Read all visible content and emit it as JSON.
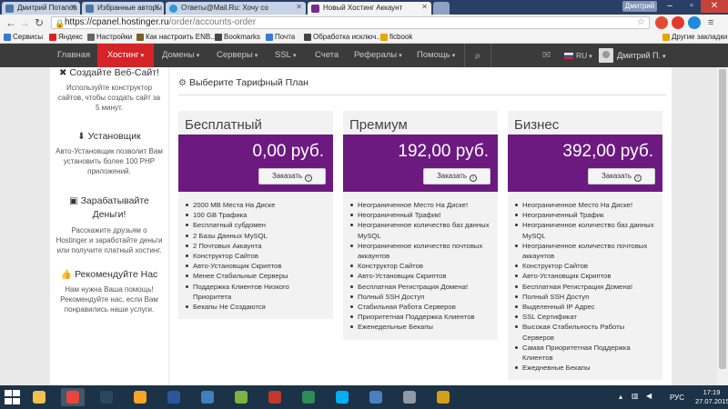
{
  "browser": {
    "tabs": [
      {
        "title": "Дмитрий Потапов",
        "color": "#4a76a8"
      },
      {
        "title": "Избранные авторы",
        "color": "#4a76a8"
      },
      {
        "title": "Ответы@Mail.Ru: Хочу со",
        "color": "#2a9bd8"
      },
      {
        "title": "Новый Хостинг Аккаунт",
        "color": "#7a2a8f",
        "active": true
      }
    ],
    "profile_name": "Дмитрий",
    "url_host": "https://cpanel.hostinger.ru",
    "url_path": "/order/accounts-order",
    "bookmarks": [
      {
        "label": "Сервисы",
        "color": "#3a78d8"
      },
      {
        "label": "Яндекс",
        "color": "#e02020"
      },
      {
        "label": "Настройки",
        "color": "#666666"
      },
      {
        "label": "Как настроить ENB...",
        "color": "#7b5e2a"
      },
      {
        "label": "Bookmarks",
        "color": "#444444"
      },
      {
        "label": "Почта",
        "color": "#3a78d8"
      },
      {
        "label": "Обработка исключ...",
        "color": "#444444"
      },
      {
        "label": "ficbook",
        "color": "#e8a400"
      }
    ],
    "other_bookmarks": "Другие закладки"
  },
  "nav": {
    "items": [
      {
        "label": "Главная",
        "caret": false
      },
      {
        "label": "Хостинг",
        "caret": true,
        "active": true
      },
      {
        "label": "Домены",
        "caret": true
      },
      {
        "label": "Серверы",
        "caret": true
      },
      {
        "label": "SSL",
        "caret": true
      },
      {
        "label": "Счета",
        "caret": false
      },
      {
        "label": "Рефералы",
        "caret": true
      },
      {
        "label": "Помощь",
        "caret": true
      }
    ],
    "language": "RU",
    "user": "Дмитрий П."
  },
  "sidebar": {
    "promos": [
      {
        "icon": "wrench-icon",
        "title": "Создайте Веб-Сайт!",
        "text": "Используйте конструктор сайтов, чтобы создать сайт за 5 минут."
      },
      {
        "icon": "download-icon",
        "title": "Установщик",
        "text": "Авто-Установщик позволит Вам установить более 100 PHP приложений."
      },
      {
        "icon": "money-icon",
        "title": "Зарабатывайте Деньги!",
        "text": "Расскажите друзьям о Hostinger и заработайте деньги или получите платный хостинг."
      },
      {
        "icon": "thumbs-up-icon",
        "title": "Рекомендуйте Нас",
        "text": "Нам нужна Ваша помощь! Рекомендуйте нас, если Вам понравились наши услуги."
      }
    ]
  },
  "main": {
    "title": "Выберите Тарифный План",
    "plans": [
      {
        "name": "Бесплатный",
        "price": "0,00 руб.",
        "button": "Заказать",
        "features": [
          "2000 MB Места На Диске",
          "100 GB Трафика",
          "Бесплатный субдомен",
          "2 Базы Данных MySQL",
          "2 Почтовых Аккаунта",
          "Конструктор Сайтов",
          "Авто-Установщик Скриптов",
          "Менее Стабильные Серверы",
          "Поддержка Клиентов Низкого Приоритета",
          "Бекапы Не Создаются"
        ]
      },
      {
        "name": "Премиум",
        "price": "192,00 руб.",
        "button": "Заказать",
        "features": [
          "Неограниченное Место На Диске!",
          "Неограниченный Трафик!",
          "Неограниченное количество баз данных MySQL",
          "Неограниченное количество почтовых аккаунтов",
          "Конструктор Сайтов",
          "Авто-Установщик Скриптов",
          "Бесплатная Регистрация Домена!",
          "Полный SSH Доступ",
          "Стабильная Работа Серверов",
          "Приоритетная Поддержка Клиентов",
          "Еженедельные Бекапы"
        ]
      },
      {
        "name": "Бизнес",
        "price": "392,00 руб.",
        "button": "Заказать",
        "features": [
          "Неограниченное Место На Диске!",
          "Неограниченный Трафик",
          "Неограниченное количество баз данных MySQL",
          "Неограниченное количество почтовых аккаунтов",
          "Конструктор Сайтов",
          "Авто-Установщик Скриптов",
          "Бесплатная Регистрация Домена!",
          "Полный SSH Доступ",
          "Выделенный IP Адрес",
          "SSL Сертификат",
          "Высокая Стабильность Работы Серверов",
          "Самая Приоритетная Поддержка Клиентов",
          "Ежедневные Бекапы"
        ]
      }
    ]
  },
  "taskbar": {
    "apps": [
      {
        "name": "file-explorer-icon",
        "color": "#f2c14e"
      },
      {
        "name": "chrome-icon",
        "color": "#e8453c",
        "active": true
      },
      {
        "name": "steam-icon",
        "color": "#2a475e"
      },
      {
        "name": "aimp-icon",
        "color": "#f5a623"
      },
      {
        "name": "word-icon",
        "color": "#2b579a"
      },
      {
        "name": "monitor-icon",
        "color": "#3f7fbf"
      },
      {
        "name": "notepad-icon",
        "color": "#7cb342"
      },
      {
        "name": "game-icon",
        "color": "#c0392b"
      },
      {
        "name": "xbox-icon",
        "color": "#2e8b57"
      },
      {
        "name": "skype-icon",
        "color": "#00aff0"
      },
      {
        "name": "teamspeak-icon",
        "color": "#4a7fc1"
      },
      {
        "name": "photos-icon",
        "color": "#8e9aa5"
      },
      {
        "name": "go-icon",
        "color": "#d4a017"
      }
    ],
    "language": "РУС",
    "time": "17:19",
    "date": "27.07.2015"
  }
}
